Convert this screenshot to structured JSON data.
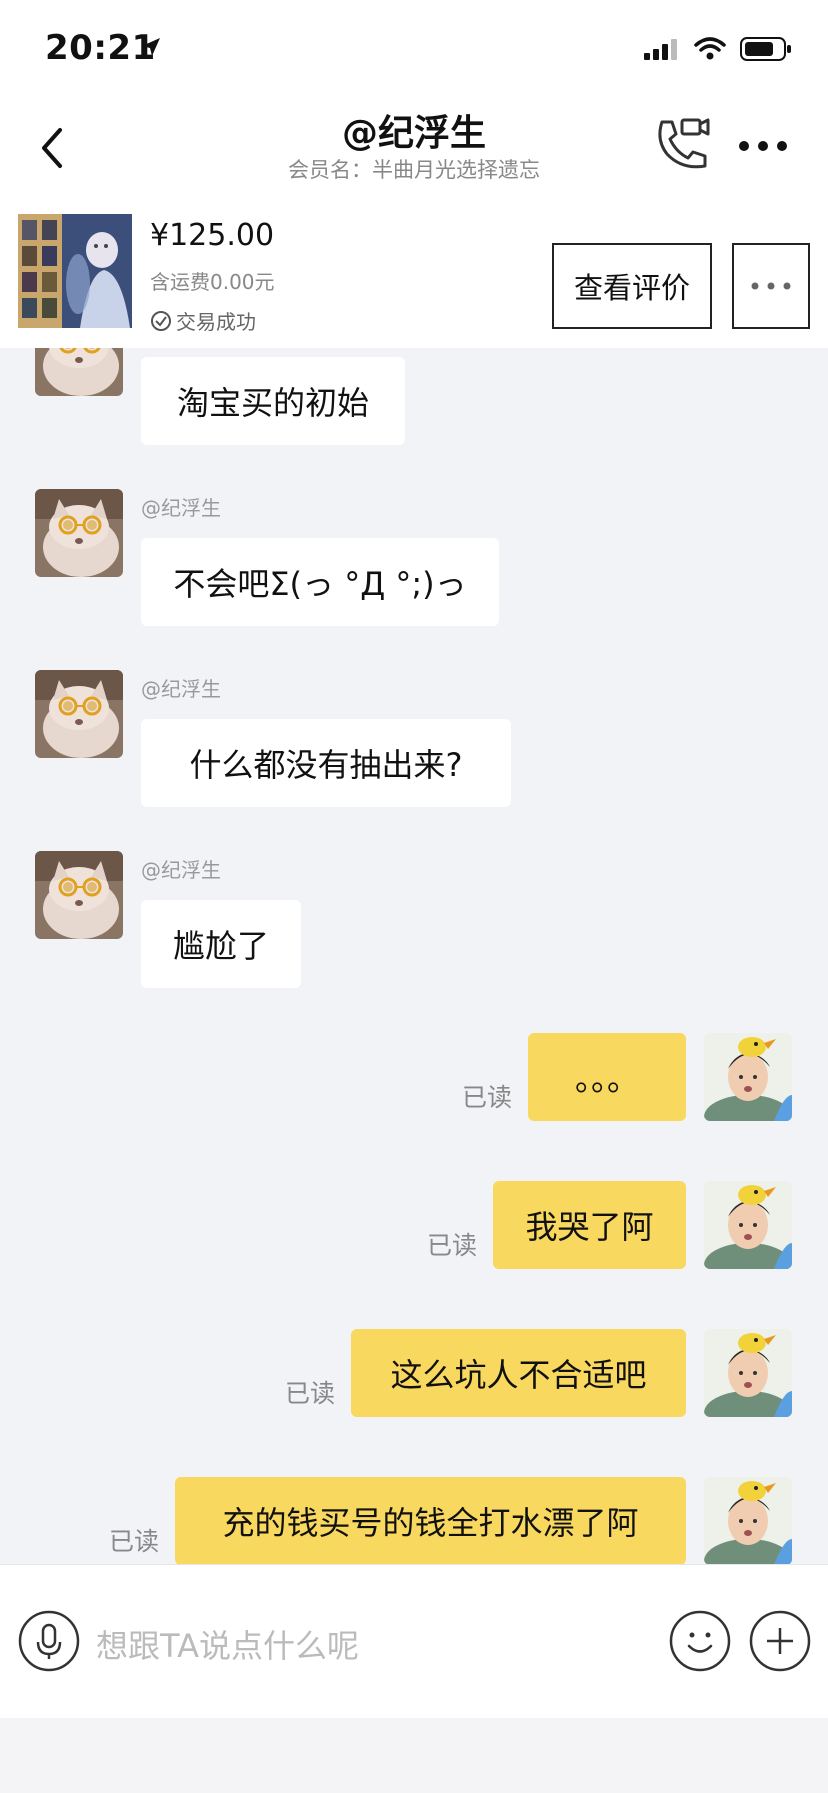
{
  "status": {
    "time": "20:21"
  },
  "header": {
    "title": "@纪浮生",
    "subtitle": "会员名：半曲月光选择遗忘"
  },
  "order": {
    "price": "¥125.00",
    "shipping": "含运费0.00元",
    "status": "交易成功",
    "review_button": "查看评价"
  },
  "messages": {
    "m0": {
      "text": "淘宝买的初始"
    },
    "m1": {
      "sender": "@纪浮生",
      "text": "不会吧Σ(っ °Д °;)っ"
    },
    "m2": {
      "sender": "@纪浮生",
      "text": "什么都没有抽出来?"
    },
    "m3": {
      "sender": "@纪浮生",
      "text": "尴尬了"
    },
    "m4": {
      "read": "已读",
      "text": "。。。"
    },
    "m5": {
      "read": "已读",
      "text": "我哭了阿"
    },
    "m6": {
      "read": "已读",
      "text": "这么坑人不合适吧"
    },
    "m7": {
      "read": "已读",
      "text": "充的钱买号的钱全打水漂了阿"
    }
  },
  "input": {
    "placeholder": "想跟TA说点什么呢"
  },
  "colors": {
    "outgoing_bubble": "#f8d85e",
    "incoming_bubble": "#ffffff",
    "chat_background": "#f2f3f7"
  },
  "icons": [
    "location-arrow-icon",
    "signal-icon",
    "wifi-icon",
    "battery-icon",
    "back-icon",
    "video-call-icon",
    "more-icon",
    "check-circle-icon",
    "mic-icon",
    "emoji-icon",
    "plus-icon"
  ]
}
